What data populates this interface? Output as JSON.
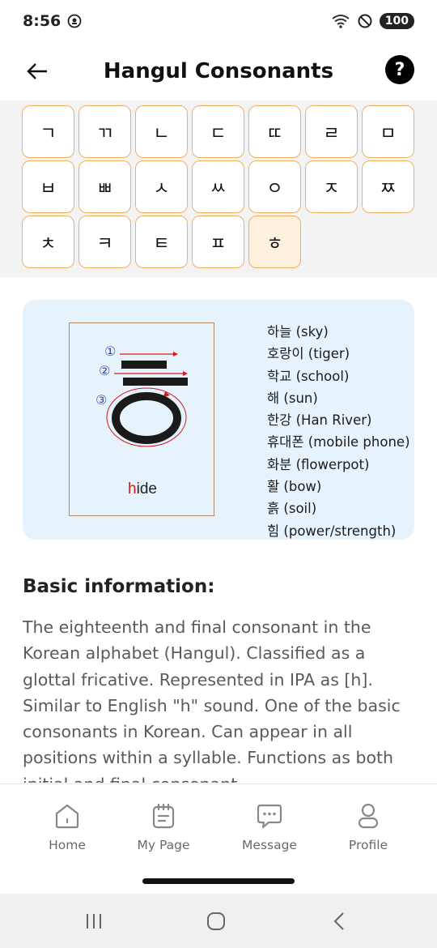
{
  "status_bar": {
    "time": "8:56",
    "battery": "100"
  },
  "header": {
    "title": "Hangul Consonants"
  },
  "consonants": [
    "ㄱ",
    "ㄲ",
    "ㄴ",
    "ㄷ",
    "ㄸ",
    "ㄹ",
    "ㅁ",
    "ㅂ",
    "ㅃ",
    "ㅅ",
    "ㅆ",
    "ㅇ",
    "ㅈ",
    "ㅉ",
    "ㅊ",
    "ㅋ",
    "ㅌ",
    "ㅍ",
    "ㅎ"
  ],
  "selected_consonant": "ㅎ",
  "stroke_diagram": {
    "character": "ㅎ",
    "stroke_numbers": [
      "①",
      "②",
      "③"
    ],
    "word_highlight": "h",
    "word_rest": "ide"
  },
  "examples": [
    "하늘 (sky)",
    "호랑이 (tiger)",
    "학교 (school)",
    "해 (sun)",
    "한강 (Han River)",
    "휴대폰 (mobile phone)",
    "화분 (flowerpot)",
    "활 (bow)",
    "흙 (soil)",
    "힘 (power/strength)"
  ],
  "info": {
    "heading": "Basic information:",
    "text": "The eighteenth and final consonant in the Korean alphabet (Hangul). Classified as a glottal fricative. Represented in IPA as [h]. Similar to English \"h\" sound. One of the basic consonants in Korean. Can appear in all positions within a syllable. Functions as both initial and final consonant."
  },
  "bottom_nav": {
    "home": "Home",
    "my_page": "My Page",
    "message": "Message",
    "profile": "Profile"
  },
  "colors": {
    "accent_border": "#f0b060",
    "selected_bg": "#fdf0dc",
    "card_bg": "#e6f2fc",
    "highlight_red": "#d21c1c"
  },
  "icons": {
    "back": "arrow-left-icon",
    "help": "question-circle-icon",
    "home": "home-icon",
    "my_page": "notepad-icon",
    "message": "chat-bubble-icon",
    "profile": "person-icon"
  }
}
